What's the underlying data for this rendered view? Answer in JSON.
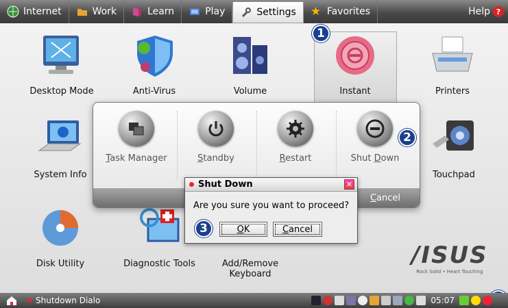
{
  "tabs": [
    {
      "label": "Internet",
      "icon": "globe-icon"
    },
    {
      "label": "Work",
      "icon": "folder-icon"
    },
    {
      "label": "Learn",
      "icon": "book-icon"
    },
    {
      "label": "Play",
      "icon": "game-icon"
    },
    {
      "label": "Settings",
      "icon": "wrench-icon",
      "active": true
    },
    {
      "label": "Favorites",
      "icon": "star-icon"
    }
  ],
  "help": {
    "label": "Help",
    "glyph": "?"
  },
  "items": {
    "desktop_mode": "Desktop Mode",
    "anti_virus": "Anti-Virus",
    "volume": "Volume",
    "instant": "Instant",
    "printers": "Printers",
    "system_info": "System Info",
    "touchpad": "Touchpad",
    "disk_utility": "Disk Utility",
    "diagnostic_tools": "Diagnostic Tools",
    "add_remove_line1": "Add/Remove",
    "add_remove_line2": "Keyboard"
  },
  "panel": {
    "buttons": [
      {
        "label": "Task Manager",
        "underline": "T",
        "rest": "ask Manager"
      },
      {
        "label": "Standby",
        "underline": "S",
        "rest": "tandby"
      },
      {
        "label": "Restart",
        "underline": "R",
        "rest": "estart"
      },
      {
        "label": "Shut Down",
        "pre": "Shut ",
        "underline": "D",
        "rest": "own"
      }
    ],
    "cancel_pre": "",
    "cancel_underline": "C",
    "cancel_rest": "ancel"
  },
  "dialog": {
    "title": "Shut Down",
    "message": "Are you sure you want to proceed?",
    "ok_underline": "O",
    "ok_rest": "K",
    "cancel_underline": "C",
    "cancel_rest": "ancel",
    "close_glyph": "✕"
  },
  "callouts": {
    "one": "1",
    "two": "2",
    "three": "3",
    "four": "1"
  },
  "taskbar": {
    "task_label": "Shutdown Dialo",
    "clock": "05:07"
  },
  "brand": {
    "logo": "/ISUS",
    "tagline": "Rock Solid • Heart Touching"
  },
  "colors": {
    "accent": "#1a3f8e",
    "alert": "#e23333"
  }
}
